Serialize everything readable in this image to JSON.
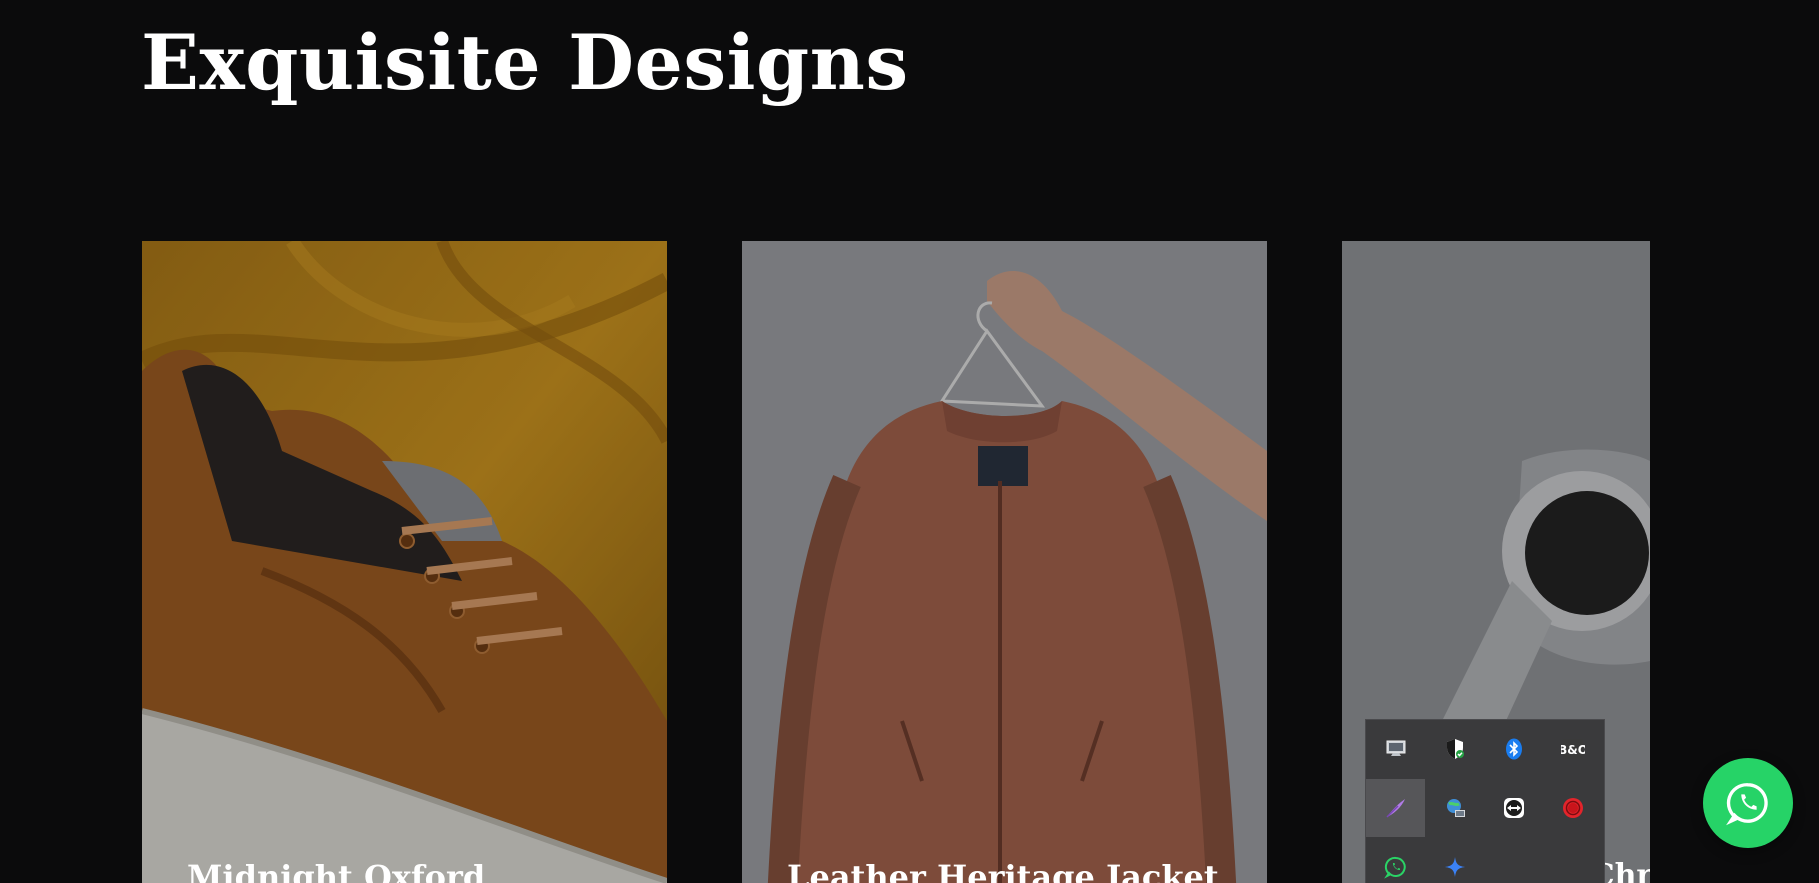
{
  "page": {
    "title": "Exquisite Designs"
  },
  "products": [
    {
      "name": "Midnight Oxford",
      "image": "sneaker-on-mustard-fabric"
    },
    {
      "name": "Leather Heritage Jacket",
      "image": "bomber-jacket-on-hanger"
    },
    {
      "name": "Onyx Chronograph",
      "image": "smartwatch-on-grey"
    }
  ],
  "tray": {
    "icons": [
      "display-icon",
      "security-shield-icon",
      "bluetooth-icon",
      "app-bo-icon",
      "feather-pen-icon",
      "network-globe-icon",
      "teamviewer-icon",
      "record-icon",
      "whatsapp-icon",
      "sparkle-icon"
    ]
  },
  "whatsapp_button": {
    "icon": "whatsapp-icon",
    "color": "#26d367"
  },
  "colors": {
    "background": "#0b0b0c",
    "title": "#ffffff",
    "card_1": "#b8851f",
    "card_2": "#9b9da2",
    "card_3": "#8e9094"
  }
}
